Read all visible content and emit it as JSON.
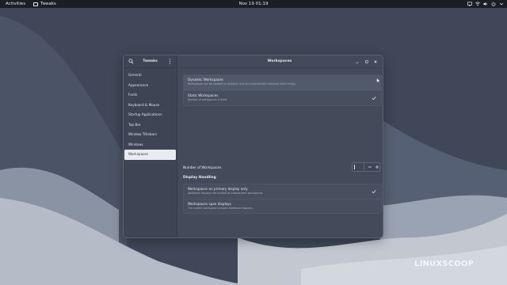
{
  "topbar": {
    "activities": "Activities",
    "app_name": "Tweaks",
    "clock": "Nov 19  01:19",
    "tray_icons": [
      "screen-icon",
      "network-icon",
      "volume-icon",
      "power-icon",
      "chevron-down-icon"
    ]
  },
  "window": {
    "sidebar_title": "Tweaks",
    "content_title": "Workspaces",
    "sidebar_items": [
      {
        "label": "General",
        "active": false
      },
      {
        "label": "Appearance",
        "active": false
      },
      {
        "label": "Fonts",
        "active": false
      },
      {
        "label": "Keyboard & Mouse",
        "active": false
      },
      {
        "label": "Startup Applications",
        "active": false
      },
      {
        "label": "Top Bar",
        "active": false
      },
      {
        "label": "Window Titlebars",
        "active": false
      },
      {
        "label": "Windows",
        "active": false
      },
      {
        "label": "Workspaces",
        "active": true
      }
    ],
    "workspace_mode": {
      "dynamic": {
        "label": "Dynamic Workspaces",
        "description": "Workspaces can be created on demand, and are automatically removed when empty.",
        "checked": false
      },
      "static": {
        "label": "Static Workspaces",
        "description": "Number of workspaces is fixed.",
        "checked": true
      }
    },
    "number_of_workspaces": {
      "label": "Number of Workspaces",
      "value": "",
      "minus": "−",
      "plus": "+"
    },
    "display_handling": {
      "heading": "Display Handling",
      "primary_only": {
        "label": "Workspaces on primary display only",
        "description": "Additional displays are treated as independent workspaces.",
        "checked": true
      },
      "span_displays": {
        "label": "Workspaces span displays",
        "description": "The current workspace includes additional displays.",
        "checked": false
      }
    }
  },
  "watermark": "LINUXSCOOP",
  "colors": {
    "topbar": "#1b1e24",
    "window_bg": "#434b5a",
    "sidebar_bg": "#3d4454",
    "active_item": "#e8ebef"
  }
}
